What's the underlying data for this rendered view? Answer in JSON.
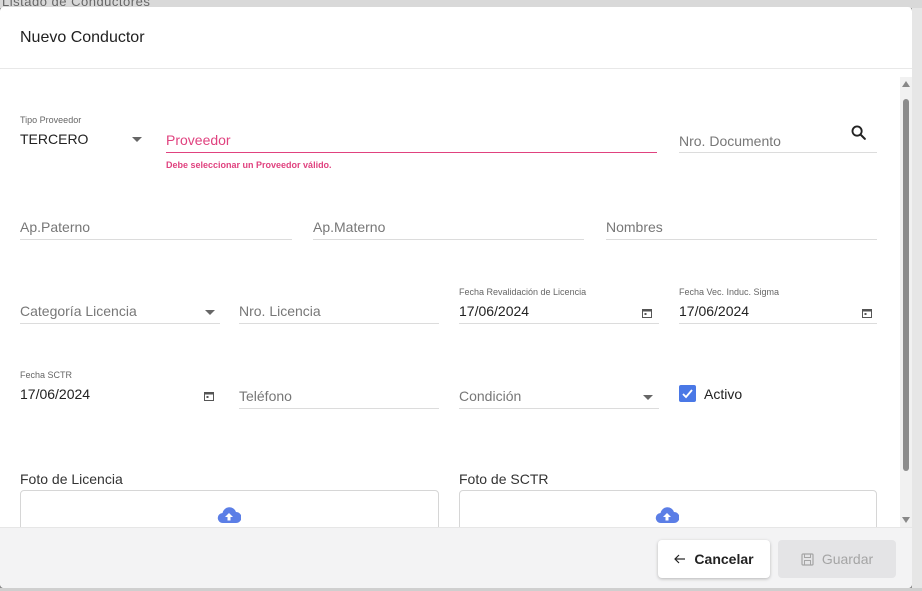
{
  "background": {
    "title_fragment": "Listado de Conductores"
  },
  "dialog": {
    "title": "Nuevo Conductor"
  },
  "form": {
    "tipo_proveedor": {
      "label": "Tipo Proveedor",
      "value": "TERCERO"
    },
    "proveedor": {
      "placeholder": "Proveedor",
      "error": "Debe seleccionar un Proveedor válido."
    },
    "nro_documento": {
      "placeholder": "Nro. Documento"
    },
    "ap_paterno": {
      "placeholder": "Ap.Paterno"
    },
    "ap_materno": {
      "placeholder": "Ap.Materno"
    },
    "nombres": {
      "placeholder": "Nombres"
    },
    "categoria_licencia": {
      "placeholder": "Categoría Licencia"
    },
    "nro_licencia": {
      "placeholder": "Nro. Licencia"
    },
    "fecha_revalidacion": {
      "label": "Fecha Revalidación de Licencia",
      "value": "17/06/2024"
    },
    "fecha_vec_induc": {
      "label": "Fecha Vec. Induc. Sigma",
      "value": "17/06/2024"
    },
    "fecha_sctr": {
      "label": "Fecha SCTR",
      "value": "17/06/2024"
    },
    "telefono": {
      "placeholder": "Teléfono"
    },
    "condicion": {
      "placeholder": "Condición"
    },
    "activo": {
      "label": "Activo",
      "checked": true
    },
    "foto_licencia": {
      "label": "Foto de Licencia"
    },
    "foto_sctr": {
      "label": "Foto de SCTR"
    }
  },
  "footer": {
    "cancel_label": "Cancelar",
    "save_label": "Guardar"
  },
  "colors": {
    "accent": "#4a78e6",
    "error": "#e0427f",
    "upload_icon": "#5b7ee6"
  },
  "icons": [
    "search-icon",
    "calendar-icon",
    "cloud-upload-icon",
    "arrow-left-icon",
    "save-icon",
    "check-icon",
    "chevron-down-icon"
  ]
}
